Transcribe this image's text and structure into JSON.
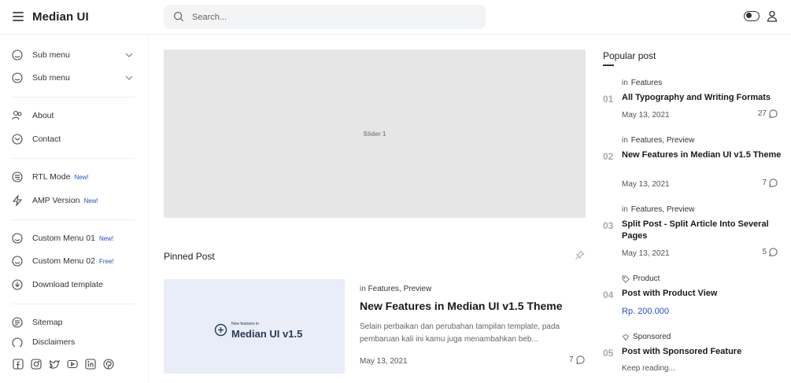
{
  "header": {
    "brand": "Median UI",
    "search_placeholder": "Search..."
  },
  "sidebar": {
    "items": [
      {
        "label": "Sub menu",
        "badge": ""
      },
      {
        "label": "Sub menu",
        "badge": ""
      },
      {
        "label": "About",
        "badge": ""
      },
      {
        "label": "Contact",
        "badge": ""
      },
      {
        "label": "RTL Mode",
        "badge": "New!"
      },
      {
        "label": "AMP Version",
        "badge": "New!"
      },
      {
        "label": "Custom Menu 01",
        "badge": "New!"
      },
      {
        "label": "Custom Menu 02",
        "badge": "Free!"
      },
      {
        "label": "Download template",
        "badge": ""
      },
      {
        "label": "Sitemap",
        "badge": ""
      },
      {
        "label": "Disclaimers",
        "badge": ""
      }
    ],
    "social_icons": [
      "facebook-icon",
      "instagram-icon",
      "twitter-icon",
      "youtube-icon",
      "linkedin-icon",
      "pinterest-icon"
    ]
  },
  "main": {
    "slider_label": "Slider 1",
    "pinned_title": "Pinned Post",
    "pinned": {
      "thumb_small": "New features in",
      "thumb_big": "Median UI v1.5",
      "meta_prefix": "in",
      "categories": "Features, Preview",
      "title": "New Features in Median UI v1.5 Theme",
      "excerpt": "Selain perbaikan dan perubahan tampilan template, pada pembaruan kali ini kamu juga menambahkan beb...",
      "date": "May 13, 2021",
      "comments": "7"
    }
  },
  "popular": {
    "heading": "Popular post",
    "posts": [
      {
        "num": "01",
        "category": "Features",
        "title": "All Typography and Writing Formats",
        "date": "May 13, 2021",
        "comments": "27"
      },
      {
        "num": "02",
        "category": "Features, Preview",
        "title": "New Features in Median UI v1.5 Theme",
        "date": "May 13, 2021",
        "comments": "7"
      },
      {
        "num": "03",
        "category": "Features, Preview",
        "title": "Split Post - Split Article Into Several Pages",
        "date": "May 13, 2021",
        "comments": "5"
      },
      {
        "num": "04",
        "category": "Product",
        "title": "Post with Product View",
        "price": "Rp. 200.000"
      },
      {
        "num": "05",
        "category": "Sponsored",
        "title": "Post with Sponsored Feature",
        "read_more": "Keep reading..."
      }
    ]
  },
  "colors": {
    "accent": "#204ecf",
    "slider_bg": "#e6e6e6",
    "thumb_bg": "#e8edf7"
  }
}
